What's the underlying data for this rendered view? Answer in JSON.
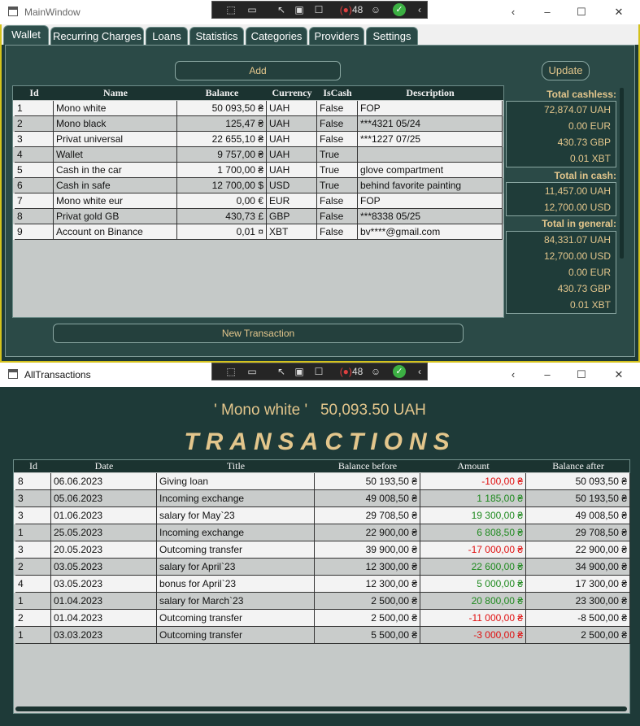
{
  "main_window": {
    "title": "MainWindow",
    "tabs": [
      "Wallet",
      "Recurring Charges",
      "Loans",
      "Statistics",
      "Categories",
      "Providers",
      "Settings"
    ],
    "add_label": "Add",
    "update_label": "Update",
    "new_transaction_label": "New Transaction",
    "columns": [
      "Id",
      "Name",
      "Balance",
      "Currency",
      "IsCash",
      "Description"
    ],
    "wallets": [
      {
        "id": "1",
        "name": "Mono white",
        "balance": "50 093,50 ₴",
        "currency": "UAH",
        "is_cash": "False",
        "description": "FOP"
      },
      {
        "id": "2",
        "name": "Mono black",
        "balance": "125,47 ₴",
        "currency": "UAH",
        "is_cash": "False",
        "description": "***4321 05/24"
      },
      {
        "id": "3",
        "name": "Privat universal",
        "balance": "22 655,10 ₴",
        "currency": "UAH",
        "is_cash": "False",
        "description": "***1227 07/25"
      },
      {
        "id": "4",
        "name": "Wallet",
        "balance": "9 757,00 ₴",
        "currency": "UAH",
        "is_cash": "True",
        "description": ""
      },
      {
        "id": "5",
        "name": "Cash in the car",
        "balance": "1 700,00 ₴",
        "currency": "UAH",
        "is_cash": "True",
        "description": "glove compartment"
      },
      {
        "id": "6",
        "name": "Cash in safe",
        "balance": "12 700,00 $",
        "currency": "USD",
        "is_cash": "True",
        "description": "behind favorite painting"
      },
      {
        "id": "7",
        "name": "Mono white eur",
        "balance": "0,00 €",
        "currency": "EUR",
        "is_cash": "False",
        "description": "FOP"
      },
      {
        "id": "8",
        "name": "Privat gold GB",
        "balance": "430,73 £",
        "currency": "GBP",
        "is_cash": "False",
        "description": "***8338 05/25"
      },
      {
        "id": "9",
        "name": "Account on Binance",
        "balance": "0,01 ¤",
        "currency": "XBT",
        "is_cash": "False",
        "description": "bv****@gmail.com"
      }
    ],
    "totals": {
      "cashless_label": "Total cashless:",
      "cashless": [
        "72,874.07 UAH",
        "0.00 EUR",
        "430.73 GBP",
        "0.01 XBT"
      ],
      "cash_label": "Total in cash:",
      "cash": [
        "11,457.00 UAH",
        "12,700.00 USD"
      ],
      "general_label": "Total in general:",
      "general": [
        "84,331.07 UAH",
        "12,700.00 USD",
        "0.00 EUR",
        "430.73 GBP",
        "0.01 XBT"
      ]
    }
  },
  "debug_toolbar": {
    "counter": "48"
  },
  "transactions_window": {
    "title": "AllTransactions",
    "wallet_name": "' Mono white '",
    "wallet_balance": "50,093.50 UAH",
    "heading": "TRANSACTIONS",
    "columns": [
      "Id",
      "Date",
      "Title",
      "Balance before",
      "Amount",
      "Balance after"
    ],
    "rows": [
      {
        "id": "8",
        "date": "06.06.2023",
        "title": "Giving loan",
        "before": "50 193,50 ₴",
        "amount": "-100,00 ₴",
        "after": "50 093,50 ₴",
        "sign": "neg"
      },
      {
        "id": "3",
        "date": "05.06.2023",
        "title": "Incoming exchange",
        "before": "49 008,50 ₴",
        "amount": "1 185,00 ₴",
        "after": "50 193,50 ₴",
        "sign": "pos"
      },
      {
        "id": "3",
        "date": "01.06.2023",
        "title": "salary for May`23",
        "before": "29 708,50 ₴",
        "amount": "19 300,00 ₴",
        "after": "49 008,50 ₴",
        "sign": "pos"
      },
      {
        "id": "1",
        "date": "25.05.2023",
        "title": "Incoming exchange",
        "before": "22 900,00 ₴",
        "amount": "6 808,50 ₴",
        "after": "29 708,50 ₴",
        "sign": "pos"
      },
      {
        "id": "3",
        "date": "20.05.2023",
        "title": "Outcoming transfer",
        "before": "39 900,00 ₴",
        "amount": "-17 000,00 ₴",
        "after": "22 900,00 ₴",
        "sign": "neg"
      },
      {
        "id": "2",
        "date": "03.05.2023",
        "title": "salary for April`23",
        "before": "12 300,00 ₴",
        "amount": "22 600,00 ₴",
        "after": "34 900,00 ₴",
        "sign": "pos"
      },
      {
        "id": "4",
        "date": "03.05.2023",
        "title": "bonus for April`23",
        "before": "12 300,00 ₴",
        "amount": "5 000,00 ₴",
        "after": "17 300,00 ₴",
        "sign": "pos"
      },
      {
        "id": "1",
        "date": "01.04.2023",
        "title": "salary for March`23",
        "before": "2 500,00 ₴",
        "amount": "20 800,00 ₴",
        "after": "23 300,00 ₴",
        "sign": "pos"
      },
      {
        "id": "2",
        "date": "01.04.2023",
        "title": "Outcoming transfer",
        "before": "2 500,00 ₴",
        "amount": "-11 000,00 ₴",
        "after": "-8 500,00 ₴",
        "sign": "neg"
      },
      {
        "id": "1",
        "date": "03.03.2023",
        "title": "Outcoming transfer",
        "before": "5 500,00 ₴",
        "amount": "-3 000,00 ₴",
        "after": "2 500,00 ₴",
        "sign": "neg"
      }
    ]
  }
}
